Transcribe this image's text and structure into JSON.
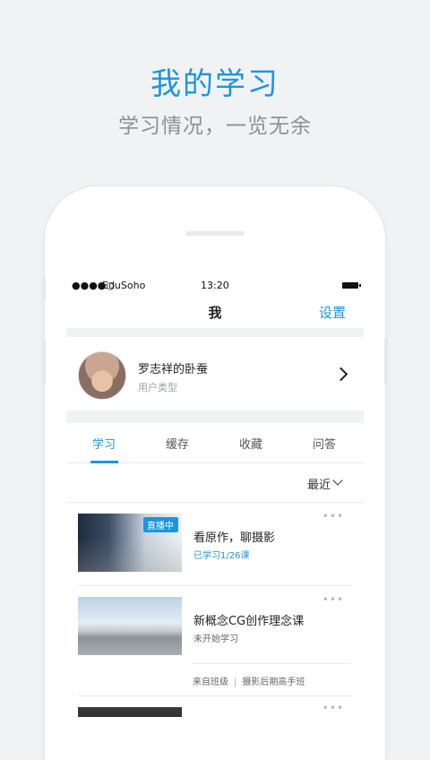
{
  "promo": {
    "headline": "我的学习",
    "subheadline": "学习情况，一览无余"
  },
  "statusbar": {
    "signal_dots": "●●●●○",
    "carrier": "EduSoho",
    "time": "13:20"
  },
  "navbar": {
    "title": "我",
    "settings_label": "设置"
  },
  "profile": {
    "name": "罗志祥的卧蚕",
    "role": "用户类型"
  },
  "tabs": [
    {
      "label": "学习",
      "active": true
    },
    {
      "label": "缓存",
      "active": false
    },
    {
      "label": "收藏",
      "active": false
    },
    {
      "label": "问答",
      "active": false
    }
  ],
  "filter": {
    "label": "最近"
  },
  "courses": [
    {
      "title": "看原作，聊摄影",
      "progress": "已学习1/26课",
      "badge": "直播中",
      "more": "•••"
    },
    {
      "title": "新概念CG创作理念课",
      "progress": "未开始学习",
      "more": "•••",
      "from_label": "来自班级",
      "class_name": "摄影后期高手班"
    },
    {
      "more": "•••"
    }
  ],
  "colors": {
    "accent": "#1b96df",
    "background": "#f1f2f4"
  }
}
